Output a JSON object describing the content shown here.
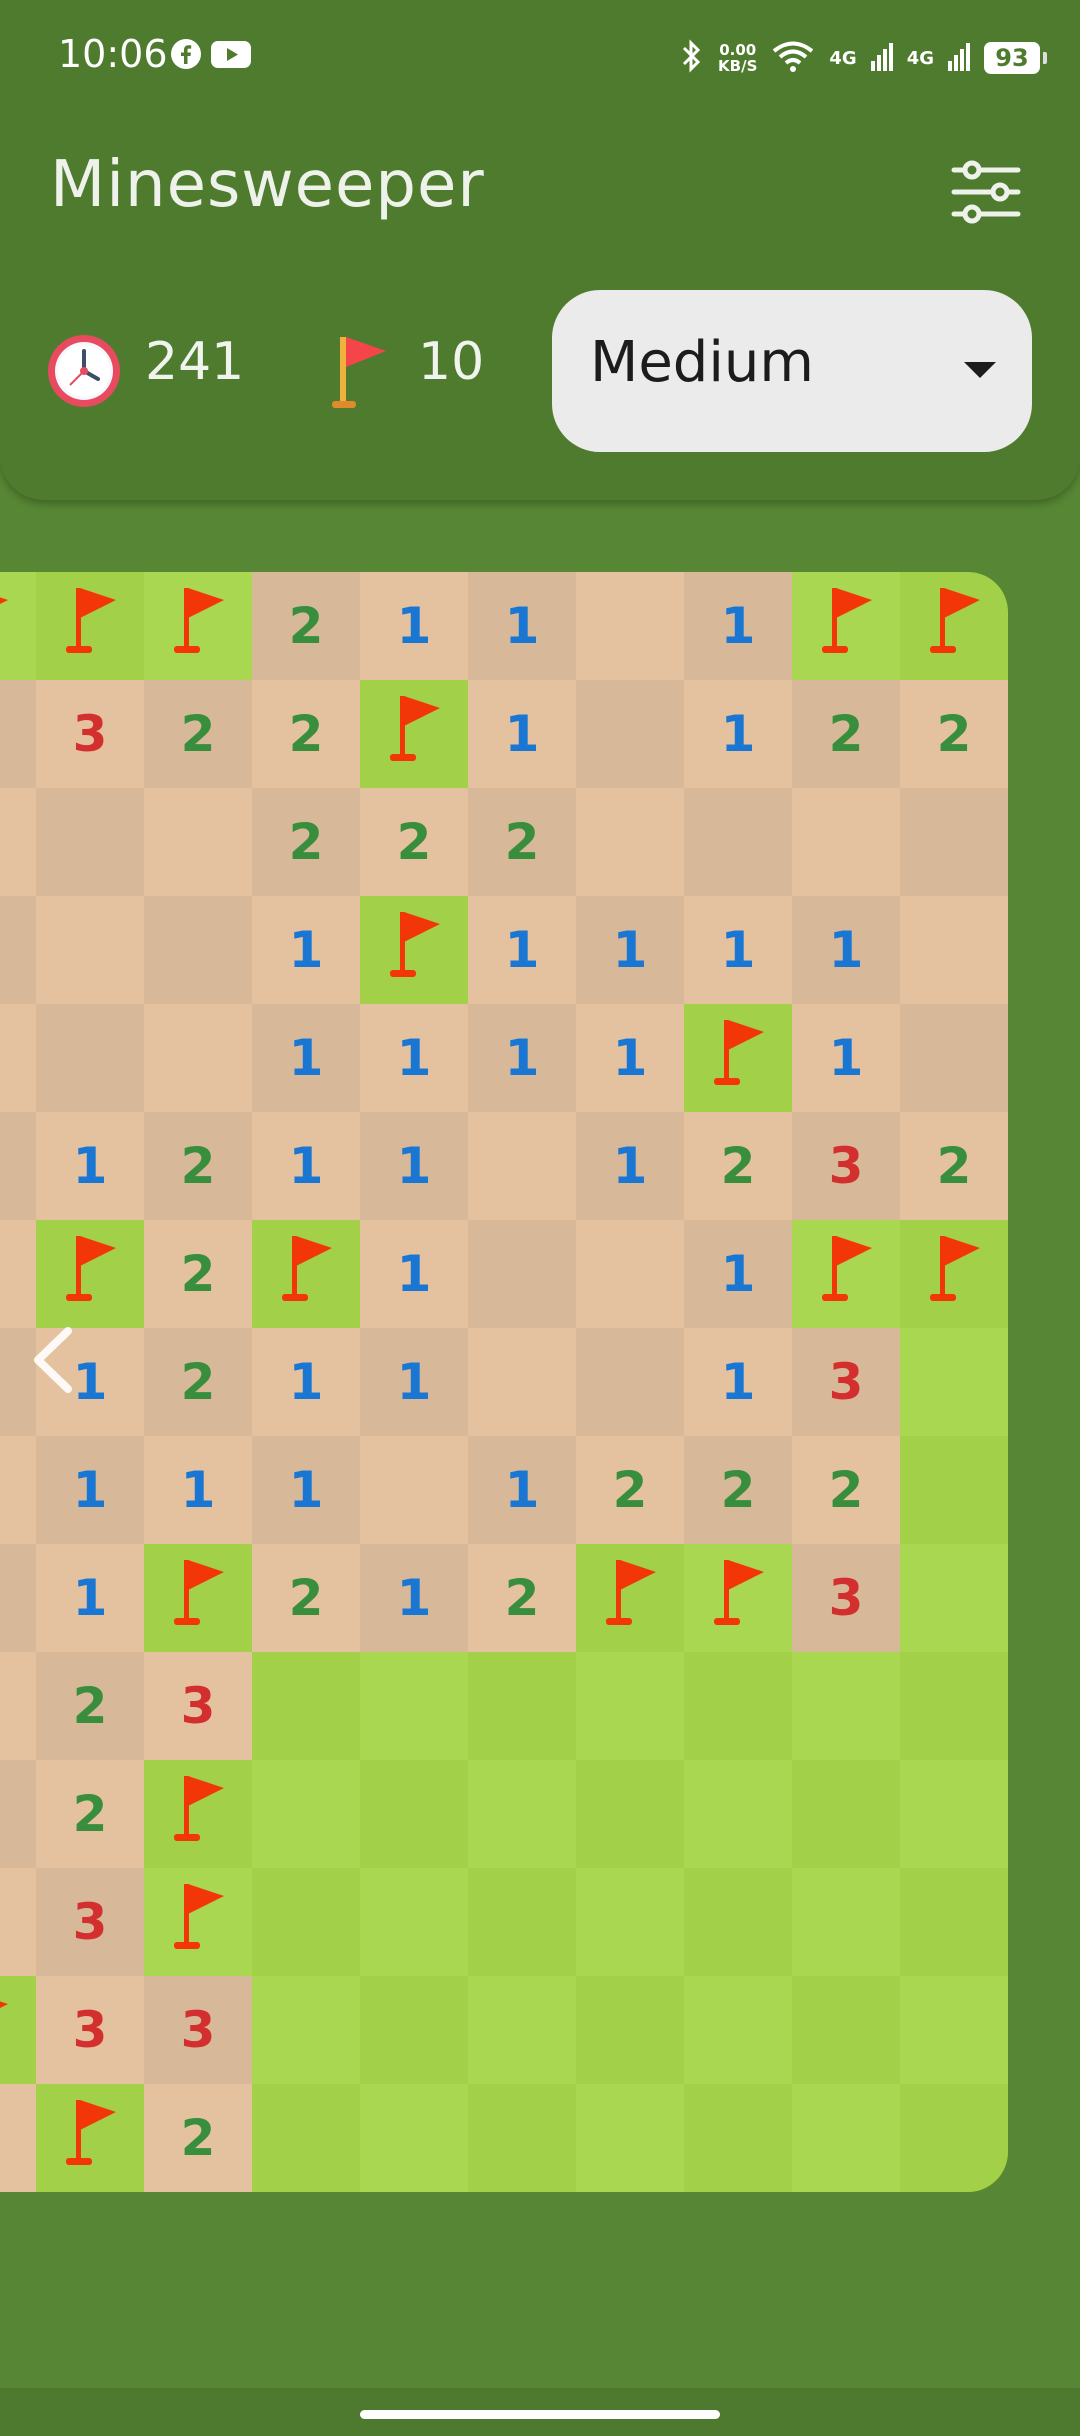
{
  "status_bar": {
    "time": "10:06",
    "net_speed_value": "0.00",
    "net_speed_unit": "KB/S",
    "net_label_1": "4G",
    "net_label_2": "4G",
    "battery": "93"
  },
  "app": {
    "title": "Minesweeper"
  },
  "stats": {
    "timer": "241",
    "flags": "10"
  },
  "difficulty": {
    "selected": "Medium"
  },
  "colors": {
    "header_bg": "#4f7b2f",
    "page_bg": "#578734",
    "revealed_light": "#e5c29f",
    "revealed_dark": "#d7b899",
    "hidden_light": "#aad751",
    "hidden_dark": "#a2d149",
    "num1": "#1976d2",
    "num2": "#388e3c",
    "num3": "#d32f2f",
    "flag": "#f23607"
  },
  "board": {
    "rows": [
      [
        "F",
        "F",
        "F",
        "2",
        "1",
        "1",
        "",
        "1",
        "F",
        "F"
      ],
      [
        "",
        "3",
        "2",
        "2",
        "F",
        "1",
        "",
        "1",
        "2",
        "2"
      ],
      [
        "",
        "",
        "",
        "2",
        "2",
        "2",
        "",
        "",
        "",
        ""
      ],
      [
        "",
        "",
        "",
        "1",
        "F",
        "1",
        "1",
        "1",
        "1",
        ""
      ],
      [
        "",
        "",
        "",
        "1",
        "1",
        "1",
        "1",
        "F",
        "1",
        ""
      ],
      [
        "",
        "1",
        "2",
        "1",
        "1",
        "",
        "1",
        "2",
        "3",
        "2"
      ],
      [
        "",
        "F",
        "2",
        "F",
        "1",
        "",
        "",
        "1",
        "F",
        "F"
      ],
      [
        "",
        "1",
        "2",
        "1",
        "1",
        "",
        "",
        "1",
        "3",
        "#"
      ],
      [
        "",
        "1",
        "1",
        "1",
        "",
        "1",
        "2",
        "2",
        "2",
        "#"
      ],
      [
        "",
        "1",
        "F",
        "2",
        "1",
        "2",
        "F",
        "F",
        "3",
        "#"
      ],
      [
        "",
        "2",
        "3",
        "#",
        "#",
        "#",
        "#",
        "#",
        "#",
        "#"
      ],
      [
        "",
        "2",
        "F",
        "#",
        "#",
        "#",
        "#",
        "#",
        "#",
        "#"
      ],
      [
        "",
        "3",
        "F",
        "#",
        "#",
        "#",
        "#",
        "#",
        "#",
        "#"
      ],
      [
        "F",
        "3",
        "3",
        "#",
        "#",
        "#",
        "#",
        "#",
        "#",
        "#"
      ],
      [
        "",
        "F",
        "2",
        "#",
        "#",
        "#",
        "#",
        "#",
        "#",
        "#"
      ]
    ]
  }
}
